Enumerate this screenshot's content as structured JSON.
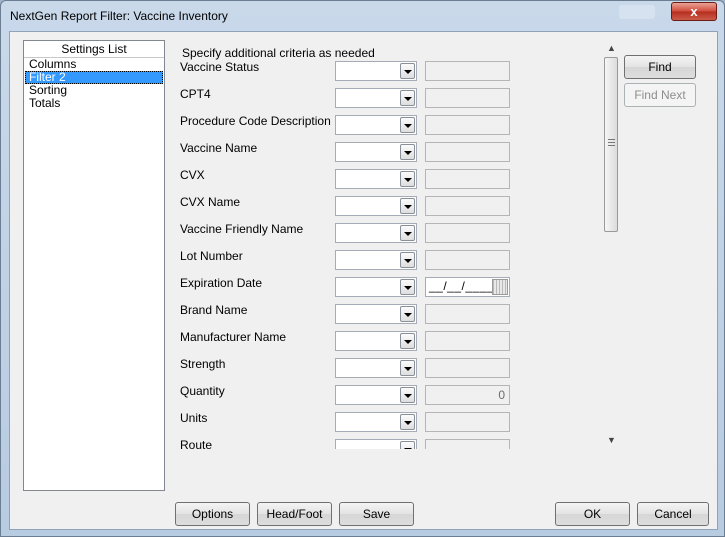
{
  "window": {
    "title": "NextGen Report Filter: Vaccine Inventory",
    "close_label": "x"
  },
  "settings_list": {
    "header": "Settings List",
    "items": [
      {
        "label": "Columns",
        "selected": false
      },
      {
        "label": "Filter 2",
        "selected": true
      },
      {
        "label": "Sorting",
        "selected": false
      },
      {
        "label": "Totals",
        "selected": false
      }
    ]
  },
  "filter": {
    "instructions": "Specify additional criteria as needed",
    "rows": [
      {
        "label": "Vaccine Status",
        "value": ""
      },
      {
        "label": "CPT4",
        "value": ""
      },
      {
        "label": "Procedure Code Description",
        "value": ""
      },
      {
        "label": "Vaccine Name",
        "value": ""
      },
      {
        "label": "CVX",
        "value": ""
      },
      {
        "label": "CVX Name",
        "value": ""
      },
      {
        "label": "Vaccine Friendly Name",
        "value": ""
      },
      {
        "label": "Lot Number",
        "value": ""
      },
      {
        "label": "Expiration Date",
        "value": "__/__/____"
      },
      {
        "label": "Brand Name",
        "value": ""
      },
      {
        "label": "Manufacturer Name",
        "value": ""
      },
      {
        "label": "Strength",
        "value": ""
      },
      {
        "label": "Quantity",
        "value": "0"
      },
      {
        "label": "Units",
        "value": ""
      },
      {
        "label": "Route",
        "value": ""
      }
    ]
  },
  "side_buttons": {
    "find": "Find",
    "find_next": "Find Next"
  },
  "bottom_buttons": {
    "options": "Options",
    "head_foot": "Head/Foot",
    "save": "Save",
    "ok": "OK",
    "cancel": "Cancel"
  },
  "icons": {
    "dropdown": "chevron-down-icon",
    "calendar": "calendar-icon",
    "close": "close-icon"
  }
}
